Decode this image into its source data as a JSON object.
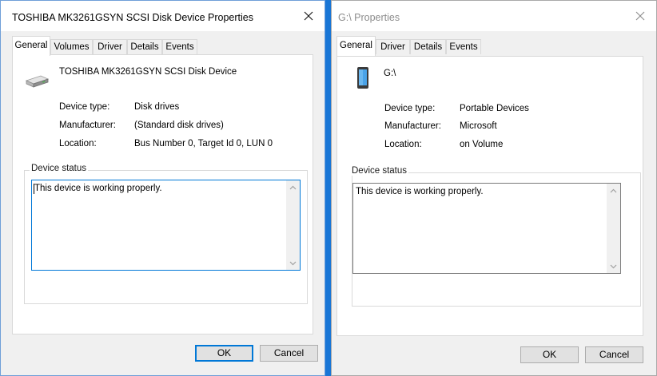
{
  "left_dialog": {
    "title": "TOSHIBA MK3261GSYN SCSI Disk Device Properties",
    "tabs": [
      "General",
      "Volumes",
      "Driver",
      "Details",
      "Events"
    ],
    "active_tab": "General",
    "device_name": "TOSHIBA MK3261GSYN SCSI Disk Device",
    "device_icon": "disk-drive-icon",
    "properties": [
      {
        "label": "Device type:",
        "value": "Disk drives"
      },
      {
        "label": "Manufacturer:",
        "value": "(Standard disk drives)"
      },
      {
        "label": "Location:",
        "value": "Bus Number 0, Target Id 0, LUN 0"
      }
    ],
    "status_group_label": "Device status",
    "status_text": "This device is working properly.",
    "ok_label": "OK",
    "cancel_label": "Cancel"
  },
  "right_dialog": {
    "title": "G:\\ Properties",
    "tabs": [
      "General",
      "Driver",
      "Details",
      "Events"
    ],
    "active_tab": "General",
    "device_name": "G:\\",
    "device_icon": "portable-device-icon",
    "properties": [
      {
        "label": "Device type:",
        "value": "Portable Devices"
      },
      {
        "label": "Manufacturer:",
        "value": "Microsoft"
      },
      {
        "label": "Location:",
        "value": "on Volume"
      }
    ],
    "status_group_label": "Device status",
    "status_text": "This device is working properly.",
    "ok_label": "OK",
    "cancel_label": "Cancel"
  },
  "colors": {
    "desktop": "#1976d6",
    "accent": "#0078d7",
    "dialog_bg": "#f0f0f0"
  }
}
